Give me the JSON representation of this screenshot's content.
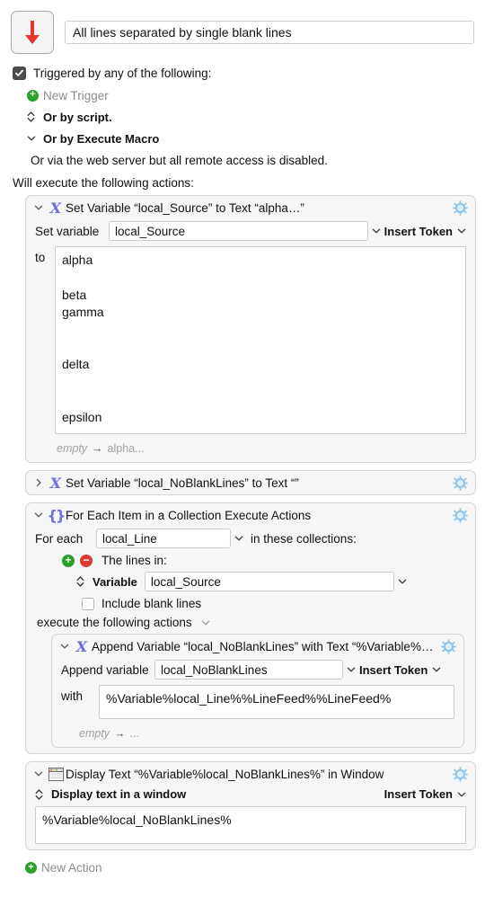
{
  "header": {
    "icon_name": "red-down-arrow-icon",
    "macro_title": "All lines separated by single blank lines"
  },
  "triggers": {
    "checkbox_label": "Triggered by any of the following:",
    "checkbox_checked": true,
    "new_trigger": "New Trigger",
    "or_by_script": "Or by script.",
    "or_by_execute_macro": "Or by Execute Macro",
    "web_server_note": "Or via the web server but all remote access is disabled."
  },
  "will_execute_label": "Will execute the following actions:",
  "actions": {
    "set_source": {
      "title": "Set Variable “local_Source” to Text “alpha…”",
      "set_variable_label": "Set variable",
      "variable_value": "local_Source",
      "insert_token": "Insert Token",
      "to_label": "to",
      "text_value": "alpha\n\nbeta\ngamma\n\n\ndelta\n\n\nepsilon",
      "footer_from": "empty",
      "footer_arrow": "→",
      "footer_to": "alpha..."
    },
    "set_noblank": {
      "title": "Set Variable “local_NoBlankLines” to Text “”"
    },
    "for_each": {
      "title": "For Each Item in a Collection Execute Actions",
      "for_each_label": "For each",
      "for_each_variable": "local_Line",
      "in_collections_label": "in these collections:",
      "the_lines_in_label": "The lines in:",
      "source_kind": "Variable",
      "source_variable": "local_Source",
      "include_blank_lines_label": "Include blank lines",
      "include_blank_lines_checked": false,
      "execute_following_label": "execute the following actions",
      "nested": {
        "title": "Append Variable “local_NoBlankLines” with Text “%Variable%…",
        "append_variable_label": "Append variable",
        "append_variable_value": "local_NoBlankLines",
        "insert_token": "Insert Token",
        "with_label": "with",
        "with_value": "%Variable%local_Line%%LineFeed%%LineFeed%",
        "footer_from": "empty",
        "footer_arrow": "→",
        "footer_to": "..."
      }
    },
    "display_text": {
      "title": "Display Text “%Variable%local_NoBlankLines%” in Window",
      "mode_label": "Display text in a window",
      "insert_token": "Insert Token",
      "text_value": "%Variable%local_NoBlankLines%"
    }
  },
  "new_action_label": "New Action",
  "colors": {
    "accent_icon": "#6f6fe0",
    "gear": "#aad4ef",
    "green": "#2aa02a",
    "red": "#d93b30",
    "arrow_red": "#e8342a"
  }
}
